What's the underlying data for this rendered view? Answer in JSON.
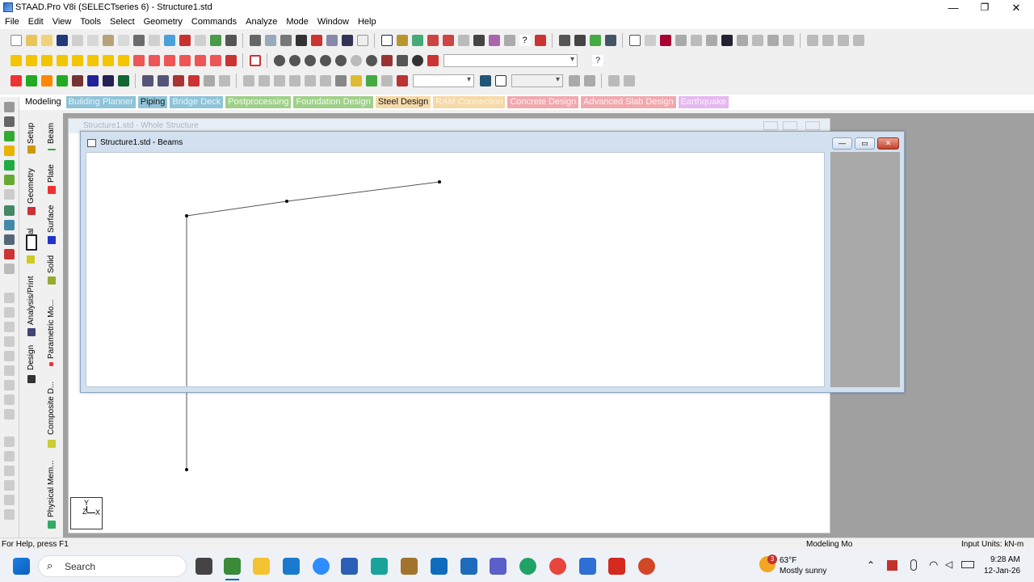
{
  "window": {
    "title": "STAAD.Pro V8i (SELECTseries 6) - Structure1.std",
    "controls": [
      "—",
      "❐",
      "✕"
    ]
  },
  "menu": [
    "File",
    "Edit",
    "View",
    "Tools",
    "Select",
    "Geometry",
    "Commands",
    "Analyze",
    "Mode",
    "Window",
    "Help"
  ],
  "mode_tabs": [
    {
      "label": "Modeling",
      "bg": "#ffffff",
      "fg": "#000000"
    },
    {
      "label": "Building Planner",
      "bg": "#8fc3d8",
      "fg": "#e8f6fb"
    },
    {
      "label": "Piping",
      "bg": "#8fc3d8",
      "fg": "#1a1a1a"
    },
    {
      "label": "Bridge Deck",
      "bg": "#8fc3d8",
      "fg": "#e8f6fb"
    },
    {
      "label": "Postprocessing",
      "bg": "#9fd08a",
      "fg": "#f2fbef"
    },
    {
      "label": "Foundation Design",
      "bg": "#9fd08a",
      "fg": "#f2fbef"
    },
    {
      "label": "Steel Design",
      "bg": "#f5d9a8",
      "fg": "#1a1a1a"
    },
    {
      "label": "RAM Connection",
      "bg": "#f5d9a8",
      "fg": "#fdf4e4"
    },
    {
      "label": "Concrete Design",
      "bg": "#f1a9ae",
      "fg": "#fff2f3"
    },
    {
      "label": "Advanced Slab Design",
      "bg": "#f1a9ae",
      "fg": "#fff2f3"
    },
    {
      "label": "Earthquake",
      "bg": "#e6b8f0",
      "fg": "#fbf0fe"
    }
  ],
  "vertical_tabs_left": [
    "Setup",
    "Geometry",
    "al",
    "Analysis/Print",
    "Design"
  ],
  "vertical_tabs_right": [
    "Beam",
    "Plate",
    "Surface",
    "Solid",
    "Parametric Mo...",
    "Composite D...",
    "Physical Mem..."
  ],
  "windows": {
    "whole_structure_title": "Structure1.std - Whole Structure",
    "beams_title": "Structure1.std - Beams"
  },
  "axis_triad": {
    "y": "Y",
    "z": "Z",
    "x": "X"
  },
  "status": {
    "help": "For Help, press F1",
    "mode": "Modeling Mo",
    "units": "Input Units:  kN-m"
  },
  "taskbar": {
    "search_placeholder": "Search",
    "weather_temp": "63°F",
    "weather_desc": "Mostly sunny",
    "weather_badge": "3",
    "time": "9:28 AM",
    "date": "12-Jan-26"
  }
}
